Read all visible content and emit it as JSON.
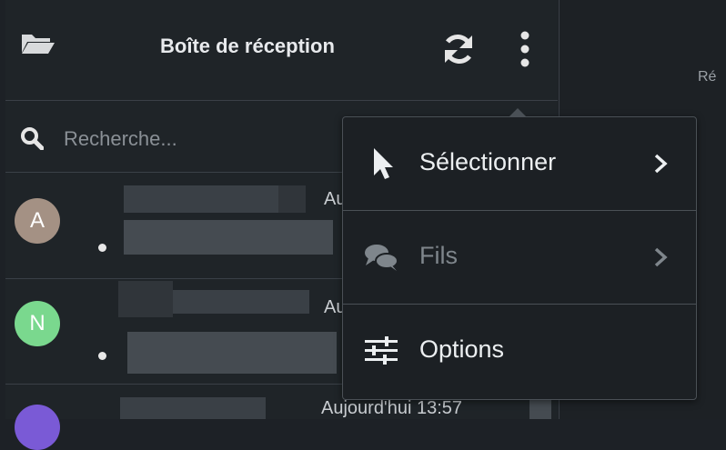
{
  "header": {
    "title": "Boîte de réception"
  },
  "search": {
    "placeholder": "Recherche..."
  },
  "messages": [
    {
      "initial": "A",
      "avatar_color": "#a49184",
      "time": "Au"
    },
    {
      "initial": "N",
      "avatar_color": "#7ad88e",
      "time": "Au"
    },
    {
      "initial": "",
      "avatar_color": "#7a5ad6",
      "time": "Aujourd'hui 13:57"
    }
  ],
  "menu": {
    "items": [
      {
        "label": "Sélectionner",
        "icon": "pointer-icon",
        "enabled": true,
        "has_submenu": true
      },
      {
        "label": "Fils",
        "icon": "chat-bubbles-icon",
        "enabled": false,
        "has_submenu": true
      },
      {
        "label": "Options",
        "icon": "sliders-icon",
        "enabled": true,
        "has_submenu": false
      }
    ]
  },
  "right_pane": {
    "clipped_text": "Ré"
  },
  "colors": {
    "background": "#1f2428",
    "border": "#3a4047",
    "menu_bg": "#1c2024",
    "text": "#eceff1",
    "disabled": "#7f868c"
  }
}
